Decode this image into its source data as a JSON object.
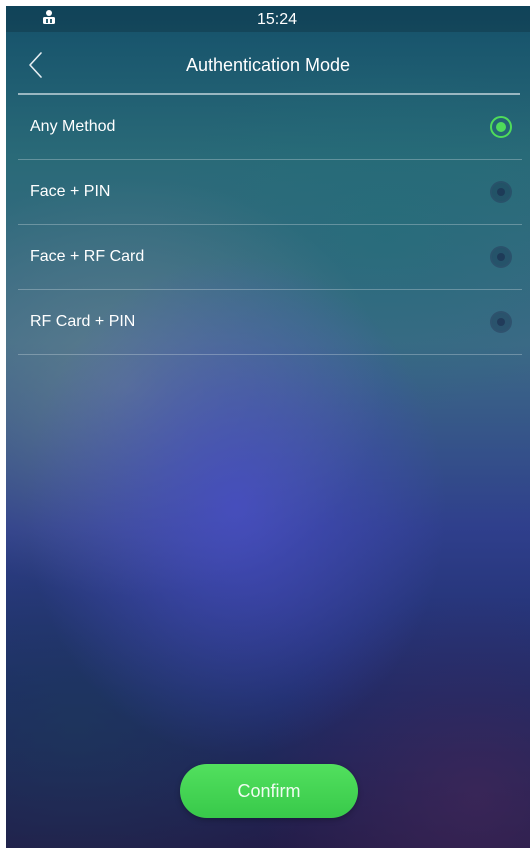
{
  "status_bar": {
    "time": "15:24",
    "icon": "user-upload-icon"
  },
  "header": {
    "title": "Authentication Mode",
    "back_icon": "chevron-left-icon"
  },
  "options": [
    {
      "label": "Any Method",
      "selected": true
    },
    {
      "label": "Face + PIN",
      "selected": false
    },
    {
      "label": "Face + RF Card",
      "selected": false
    },
    {
      "label": "RF Card + PIN",
      "selected": false
    }
  ],
  "confirm_label": "Confirm",
  "colors": {
    "accent": "#4fdc5a"
  }
}
